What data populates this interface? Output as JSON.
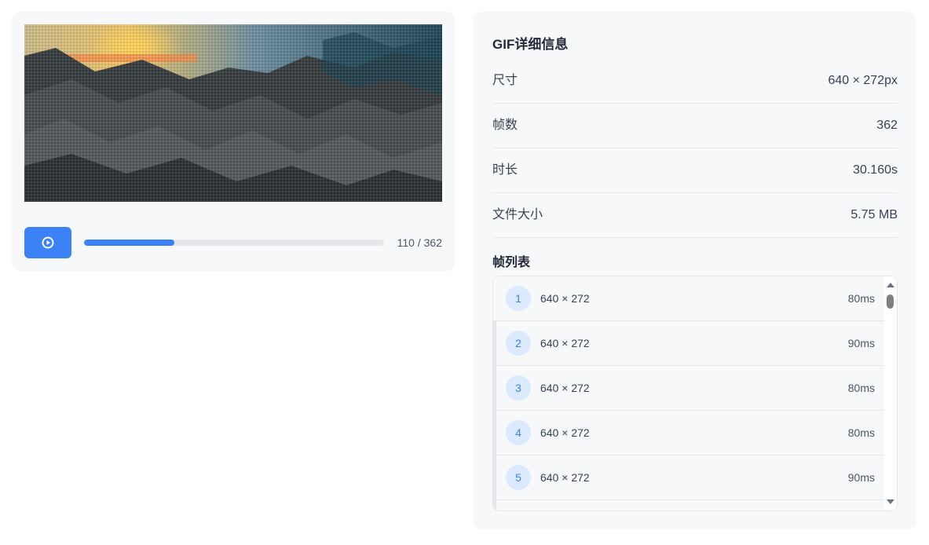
{
  "player": {
    "current_frame": 110,
    "total_frames": 362,
    "frame_counter": "110 / 362",
    "play_icon": "play-icon",
    "progress": 0.3
  },
  "info": {
    "title": "GIF详细信息",
    "rows": [
      {
        "label": "尺寸",
        "value": "640 × 272px"
      },
      {
        "label": "帧数",
        "value": "362"
      },
      {
        "label": "时长",
        "value": "30.160s"
      },
      {
        "label": "文件大小",
        "value": "5.75 MB"
      }
    ]
  },
  "frames": {
    "title": "帧列表",
    "items": [
      {
        "index": "1",
        "size": "640 × 272",
        "duration": "80ms"
      },
      {
        "index": "2",
        "size": "640 × 272",
        "duration": "90ms"
      },
      {
        "index": "3",
        "size": "640 × 272",
        "duration": "80ms"
      },
      {
        "index": "4",
        "size": "640 × 272",
        "duration": "80ms"
      },
      {
        "index": "5",
        "size": "640 × 272",
        "duration": "90ms"
      }
    ]
  },
  "colors": {
    "accent": "#3b82f6",
    "badge_bg": "#dbeafe",
    "card_bg": "#f7f8fa"
  }
}
